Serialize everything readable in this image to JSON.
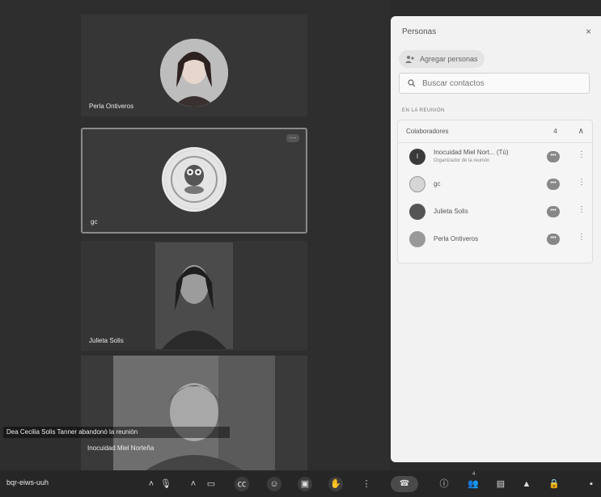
{
  "tiles": [
    {
      "name": "Perla Ontiveros"
    },
    {
      "name": "gc"
    },
    {
      "name": "Julieta Solis"
    },
    {
      "name": ""
    }
  ],
  "toast": {
    "line1": "Dea Cecilia Solis Tanner abandonó la reunión",
    "line2": "Inocuidad Miel Norteña"
  },
  "panel": {
    "title": "Personas",
    "close_icon": "×",
    "add_people_label": "Agregar personas",
    "search_placeholder": "Buscar contactos",
    "section_label": "EN LA REUNIÓN",
    "group": {
      "label": "Colaboradores",
      "count": "4"
    },
    "people": [
      {
        "name": "Inocuidad Miel Nort...",
        "suffix": "(Tú)",
        "sub": "Organizador de la reunión",
        "initial": "I"
      },
      {
        "name": "gc",
        "sub": "",
        "initial": ""
      },
      {
        "name": "Julieta Solis",
        "sub": "",
        "initial": ""
      },
      {
        "name": "Perla Ontiveros",
        "sub": "",
        "initial": ""
      }
    ]
  },
  "bottombar": {
    "meeting_code": "bqr-eiws-uuh",
    "people_badge": "4"
  }
}
